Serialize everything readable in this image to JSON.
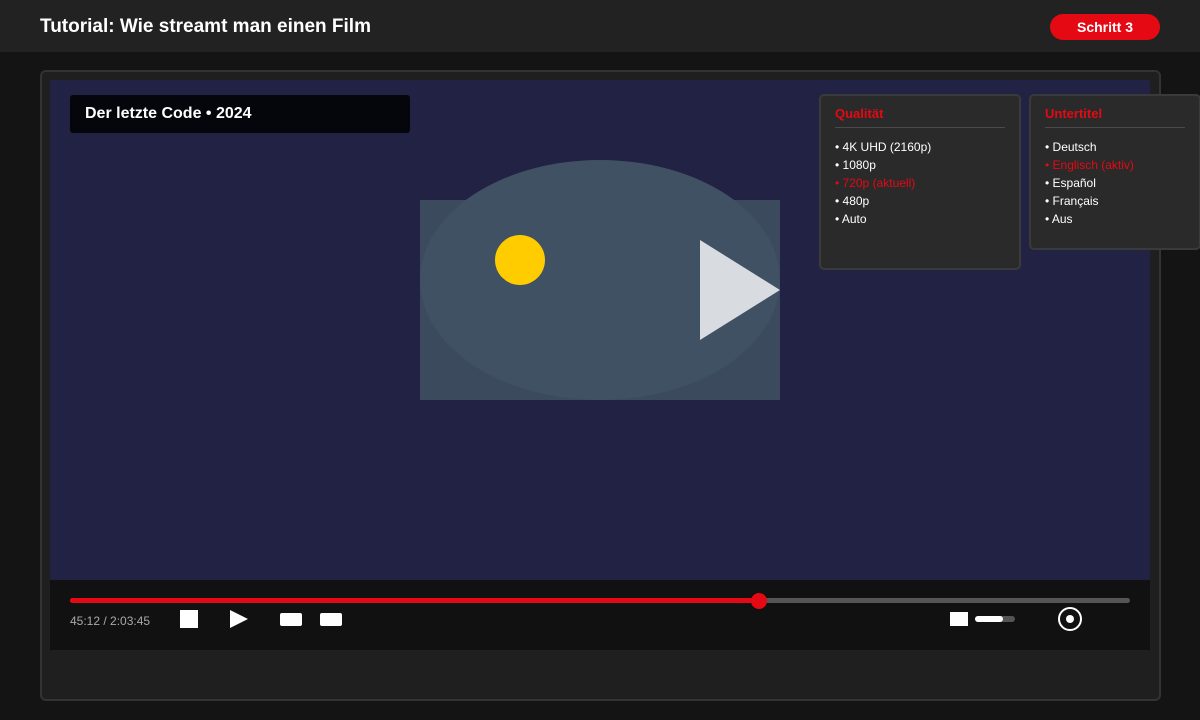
{
  "header": {
    "title": "Tutorial: Wie streamt man einen Film",
    "step_badge": "Schritt 3"
  },
  "player": {
    "movie_title": "Der letzte Code • 2024",
    "progress": 0.65,
    "time_display": "45:12 / 2:03:45",
    "volume": 0.7
  },
  "quality_menu": {
    "heading": "Qualität",
    "items": [
      {
        "label": "• 4K UHD (2160p)",
        "active": false
      },
      {
        "label": "• 1080p",
        "active": false
      },
      {
        "label": "• 720p (aktuell)",
        "active": true
      },
      {
        "label": "• 480p",
        "active": false
      },
      {
        "label": "• Auto",
        "active": false
      }
    ]
  },
  "subtitle_menu": {
    "heading": "Untertitel",
    "items": [
      {
        "label": "• Deutsch",
        "active": false
      },
      {
        "label": "• Englisch (aktiv)",
        "active": true
      },
      {
        "label": "• Español",
        "active": false
      },
      {
        "label": "• Français",
        "active": false
      },
      {
        "label": "• Aus",
        "active": false
      }
    ]
  },
  "icons": {
    "stop": "stop-icon",
    "play": "play-icon",
    "rewind": "rewind-icon",
    "forward": "forward-icon",
    "volume": "volume-icon",
    "settings": "settings-icon",
    "big_play": "play-icon"
  },
  "colors": {
    "accent": "#e50914",
    "background": "#141414",
    "video_bg": "#222244",
    "sun": "#ffcc00"
  }
}
